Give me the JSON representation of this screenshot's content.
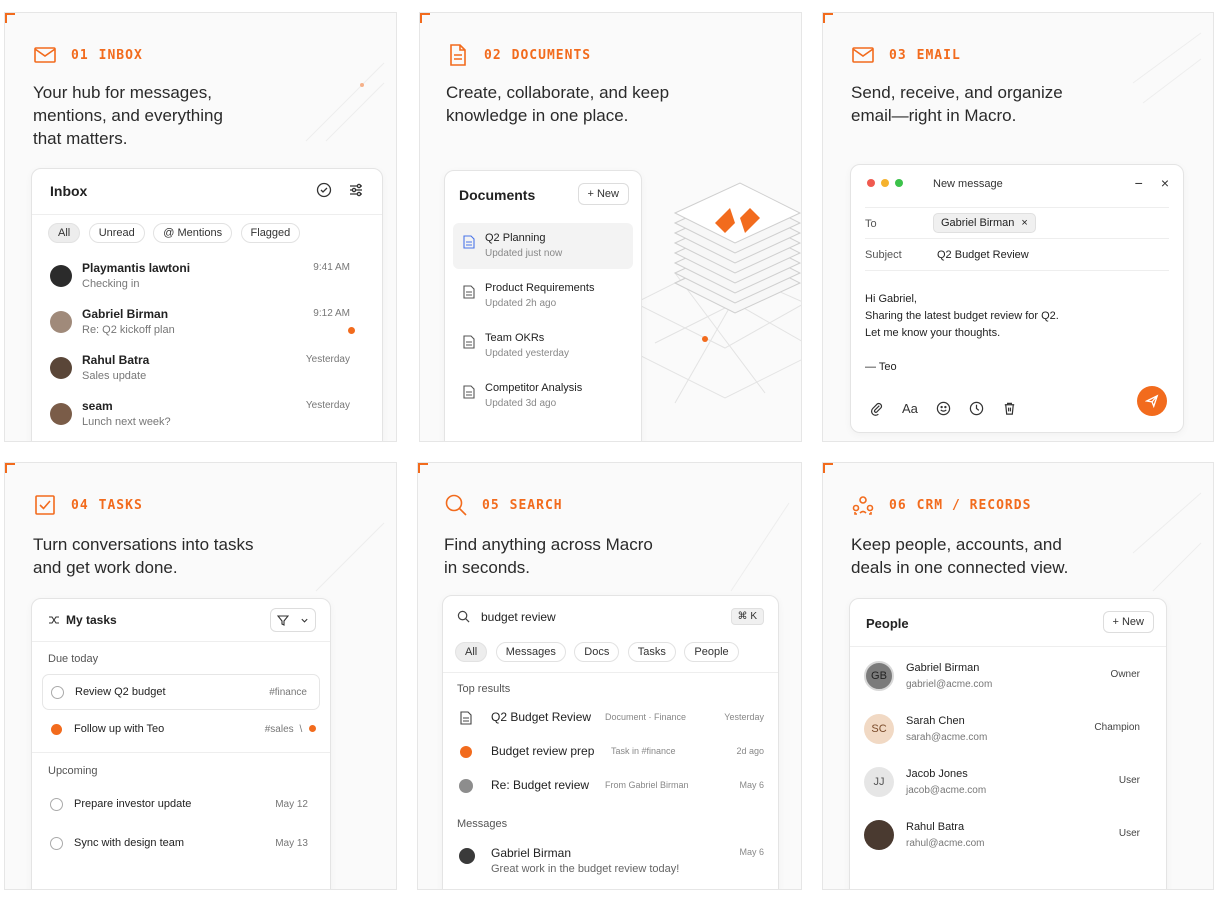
{
  "accent": "#f26b1d",
  "cards": {
    "inbox": {
      "num": "01",
      "title": "INBOX",
      "desc": [
        "Your hub for messages,",
        "mentions, and everything",
        "that matters."
      ]
    },
    "documents": {
      "num": "02",
      "title": "DOCUMENTS",
      "desc": [
        "Create, collaborate, and keep",
        "knowledge in one place."
      ]
    },
    "email": {
      "num": "03",
      "title": "EMAIL",
      "desc": [
        "Send, receive, and organize",
        "email—right in Macro."
      ]
    },
    "tasks": {
      "num": "04",
      "title": "TASKS",
      "desc": [
        "Turn conversations into tasks",
        "and get work done."
      ]
    },
    "search": {
      "num": "05",
      "title": "SEARCH",
      "desc": [
        "Find anything across Macro",
        "in seconds."
      ]
    },
    "crm": {
      "num": "06",
      "title": "CRM / RECORDS",
      "desc": [
        "Keep people, accounts, and",
        "deals in one connected view."
      ]
    }
  },
  "inbox": {
    "title": "Inbox",
    "filters": [
      "All",
      "Unread",
      "@ Mentions",
      "Flagged"
    ],
    "messages": [
      {
        "name": "Playmantis lawtoni",
        "preview": "Checking in",
        "time": "9:41 AM",
        "unread": false
      },
      {
        "name": "Gabriel Birman",
        "preview": "Re: Q2 kickoff plan",
        "time": "9:12 AM",
        "unread": true
      },
      {
        "name": "Rahul Batra",
        "preview": "Sales update",
        "time": "Yesterday",
        "unread": false
      },
      {
        "name": "seam",
        "preview": "Lunch next week?",
        "time": "Yesterday",
        "unread": false
      }
    ]
  },
  "documents": {
    "title": "Documents",
    "new_label": "New",
    "items": [
      {
        "name": "Q2 Planning",
        "sub": "Updated just now"
      },
      {
        "name": "Product Requirements",
        "sub": "Updated 2h ago"
      },
      {
        "name": "Team OKRs",
        "sub": "Updated yesterday"
      },
      {
        "name": "Competitor Analysis",
        "sub": "Updated 3d ago"
      }
    ]
  },
  "email": {
    "window_title": "New message",
    "to_label": "To",
    "to_value": "Gabriel Birman",
    "subject_label": "Subject",
    "subject_value": "Q2 Budget Review",
    "body": [
      "Hi Gabriel,",
      "Sharing the latest budget review for Q2.",
      "Let me know your thoughts.",
      "",
      "— Teo"
    ],
    "format_label": "Aa"
  },
  "tasks": {
    "title": "My tasks",
    "due_label": "Due today",
    "upcoming_label": "Upcoming",
    "due": [
      {
        "name": "Review Q2 budget",
        "tag": "#finance",
        "done": false
      },
      {
        "name": "Follow up with Teo",
        "tag": "#sales",
        "done": true
      }
    ],
    "upcoming": [
      {
        "name": "Prepare investor update",
        "tag": "May 12"
      },
      {
        "name": "Sync with design team",
        "tag": "May 13"
      }
    ]
  },
  "search": {
    "query": "budget review",
    "shortcut": "⌘ K",
    "filters": [
      "All",
      "Messages",
      "Docs",
      "Tasks",
      "People"
    ],
    "top_label": "Top results",
    "messages_label": "Messages",
    "results": [
      {
        "name": "Q2 Budget Review",
        "meta": "Document · Finance",
        "time": "Yesterday"
      },
      {
        "name": "Budget review prep",
        "meta": "Task in #finance",
        "time": "2d ago"
      },
      {
        "name": "Re: Budget review",
        "meta": "From Gabriel Birman",
        "time": "May 6"
      }
    ],
    "message": {
      "name": "Gabriel Birman",
      "preview": "Great work in the budget review today!",
      "time": "May 6"
    }
  },
  "crm": {
    "title": "People",
    "new_label": "New",
    "people": [
      {
        "initials": "GB",
        "name": "Gabriel Birman",
        "email": "gabriel@acme.com",
        "role": "Owner"
      },
      {
        "initials": "SC",
        "name": "Sarah Chen",
        "email": "sarah@acme.com",
        "role": "Champion"
      },
      {
        "initials": "JJ",
        "name": "Jacob Jones",
        "email": "jacob@acme.com",
        "role": "User"
      },
      {
        "initials": "",
        "name": "Rahul Batra",
        "email": "rahul@acme.com",
        "role": "User"
      }
    ]
  }
}
